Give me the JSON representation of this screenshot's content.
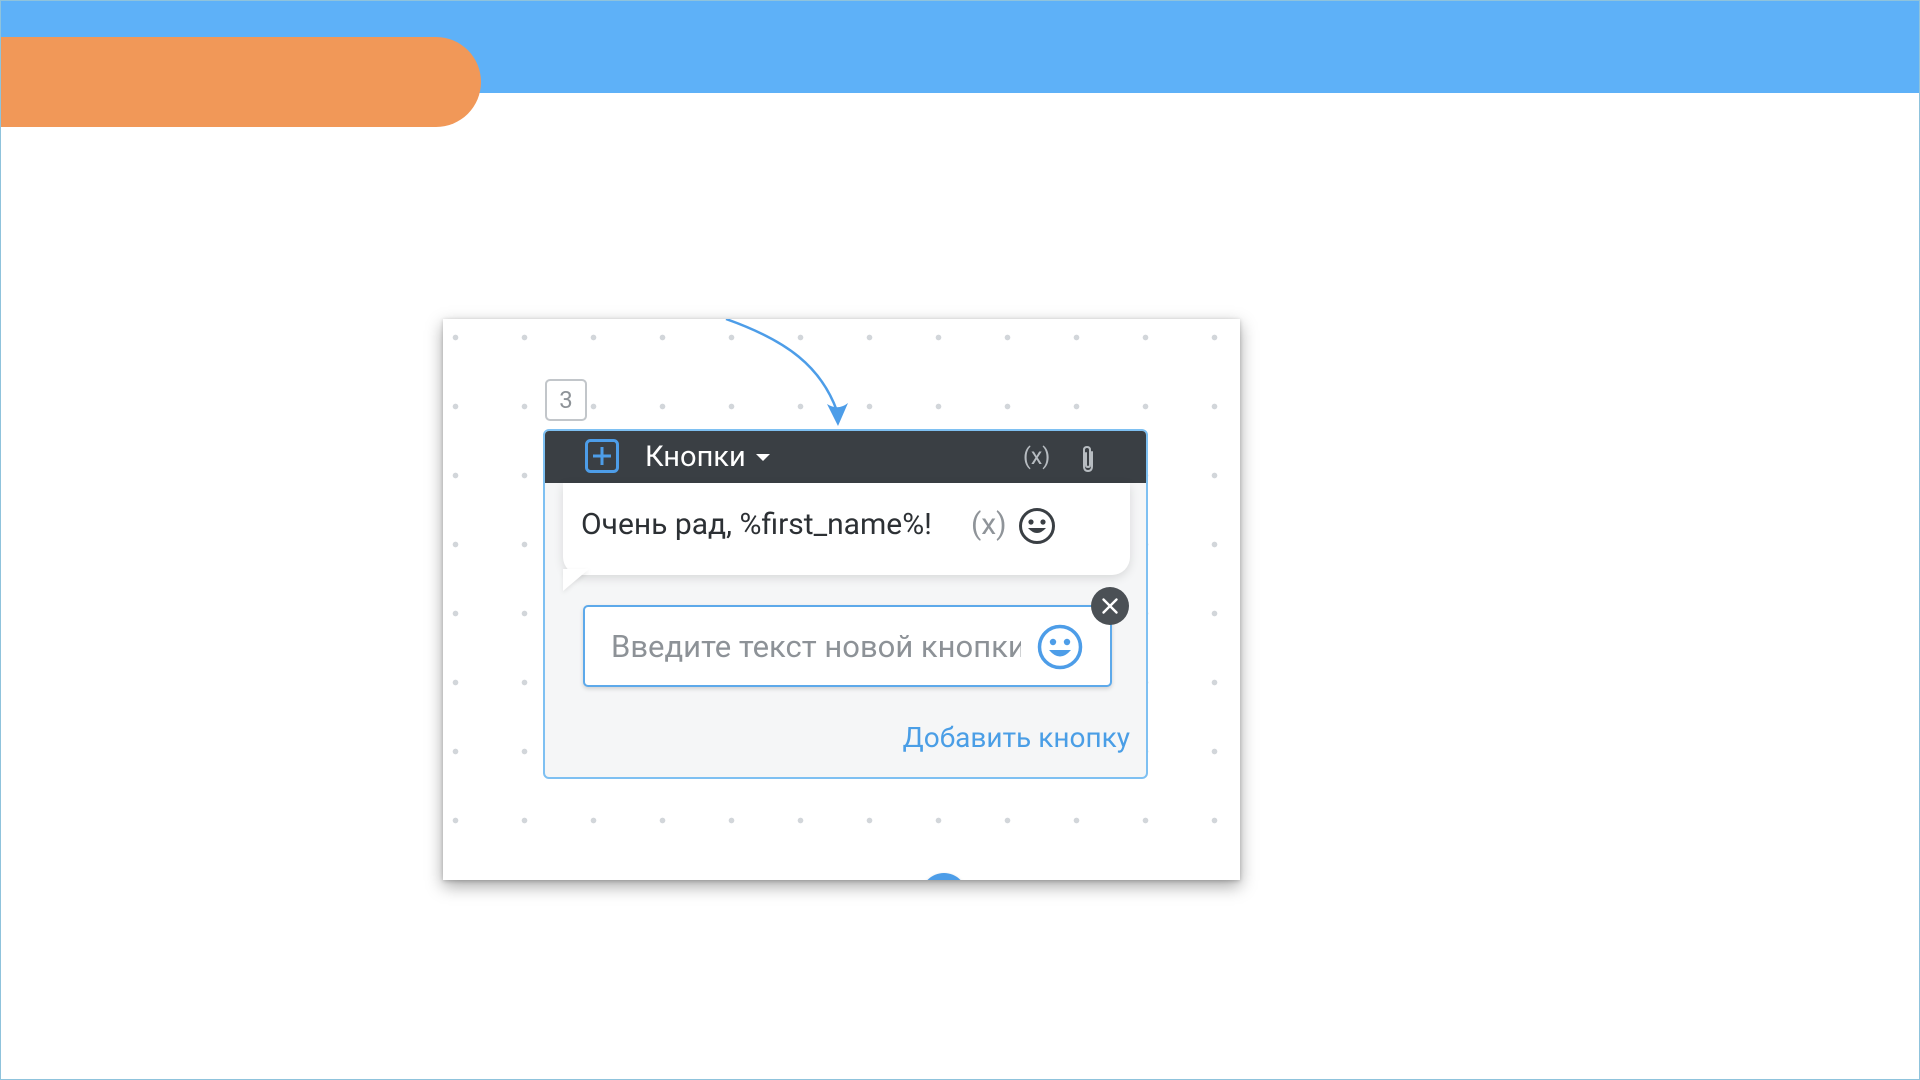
{
  "slide": {
    "colors": {
      "top_band": "#5eb1f8",
      "orange_tab": "#f19858",
      "accent_blue": "#4d9de8",
      "header_dark": "#3a3f44"
    }
  },
  "flow_block": {
    "step_number": "3",
    "block_type_label": "Кнопки",
    "block_type_icon": "add-square-icon",
    "variable_button_label": "(x)",
    "attach_icon": "paperclip-icon",
    "message": {
      "text": "Очень рад, %first_name%!",
      "variable_label": "(x)",
      "emoji_icon": "smiley-icon"
    },
    "button_input": {
      "placeholder": "Введите текст новой кнопки",
      "value": "",
      "emoji_icon": "smiley-icon",
      "remove_icon": "close-icon"
    },
    "add_button_label": "Добавить кнопку",
    "add_next_icon": "plus-circle-icon"
  }
}
